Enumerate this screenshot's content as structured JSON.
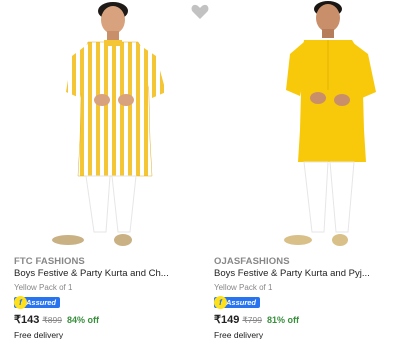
{
  "products": [
    {
      "brand": "FTC FASHIONS",
      "title": "Boys Festive & Party Kurta and Ch...",
      "variant": "Yellow Pack of 1",
      "assured_label": "Assured",
      "price": "₹143",
      "mrp": "₹899",
      "discount": "84% off",
      "delivery": "Free delivery",
      "wishlist_icon": "heart-icon",
      "image_colors": {
        "kurta": "#f4c534",
        "stripe": "#ffffff",
        "pants": "#ffffff",
        "skin": "#d9a27e",
        "hair": "#1e1a17"
      }
    },
    {
      "brand": "OJASFASHIONS",
      "title": "Boys Festive & Party Kurta and Pyj...",
      "variant": "Yellow Pack of 1",
      "assured_label": "Assured",
      "price": "₹149",
      "mrp": "₹799",
      "discount": "81% off",
      "delivery": "Free delivery",
      "image_colors": {
        "kurta": "#f8c90a",
        "pants": "#ffffff",
        "skin": "#c98f6b",
        "hair": "#1a1613"
      }
    }
  ],
  "colors": {
    "accent_blue": "#2874f0",
    "discount_green": "#388e3c",
    "muted_gray": "#878787",
    "assured_yellow": "#ffe11b",
    "wishlist_gray": "#c2c2c2"
  }
}
